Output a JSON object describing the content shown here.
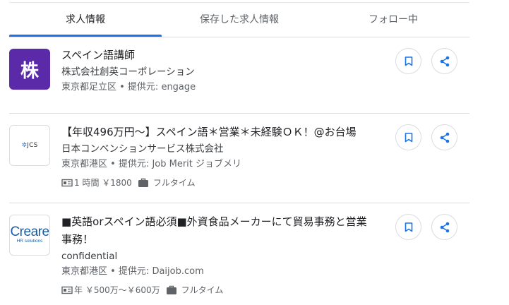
{
  "tabs": [
    {
      "label": "求人情報"
    },
    {
      "label": "保存した求人情報"
    },
    {
      "label": "フォロー中"
    }
  ],
  "jobs": [
    {
      "logo_text": "株",
      "title": "スペイン語講師",
      "company": "株式会社創英コーポレーション",
      "location": "東京都足立区 • 提供元: engage"
    },
    {
      "logo_text": "JCS",
      "title": "【年収496万円〜】スペイン語＊営業＊未経験ＯＫ！@お台場",
      "company": "日本コンベンションサービス株式会社",
      "location": "東京都港区 • 提供元: Job Merit ジョブメリ",
      "salary": "1 時間 ￥1800",
      "type": "フルタイム"
    },
    {
      "logo_text": "Creare",
      "logo_sub": "HR solutions",
      "title_line1": "■英語orスペイン語必須■外資食品メーカーにて貿易事務と営業",
      "title_line2": "事務！",
      "company": "confidential",
      "location": "東京都港区 • 提供元: Daijob.com",
      "salary": "年 ￥500万〜￥600万",
      "type": "フルタイム"
    }
  ],
  "colors": {
    "accent": "#1a73e8",
    "icon": "#1a73e8",
    "logo_purple": "#5b2aa9"
  },
  "icons": {
    "save": "bookmark-icon",
    "share": "share-icon",
    "salary": "salary-icon",
    "type": "briefcase-icon"
  }
}
